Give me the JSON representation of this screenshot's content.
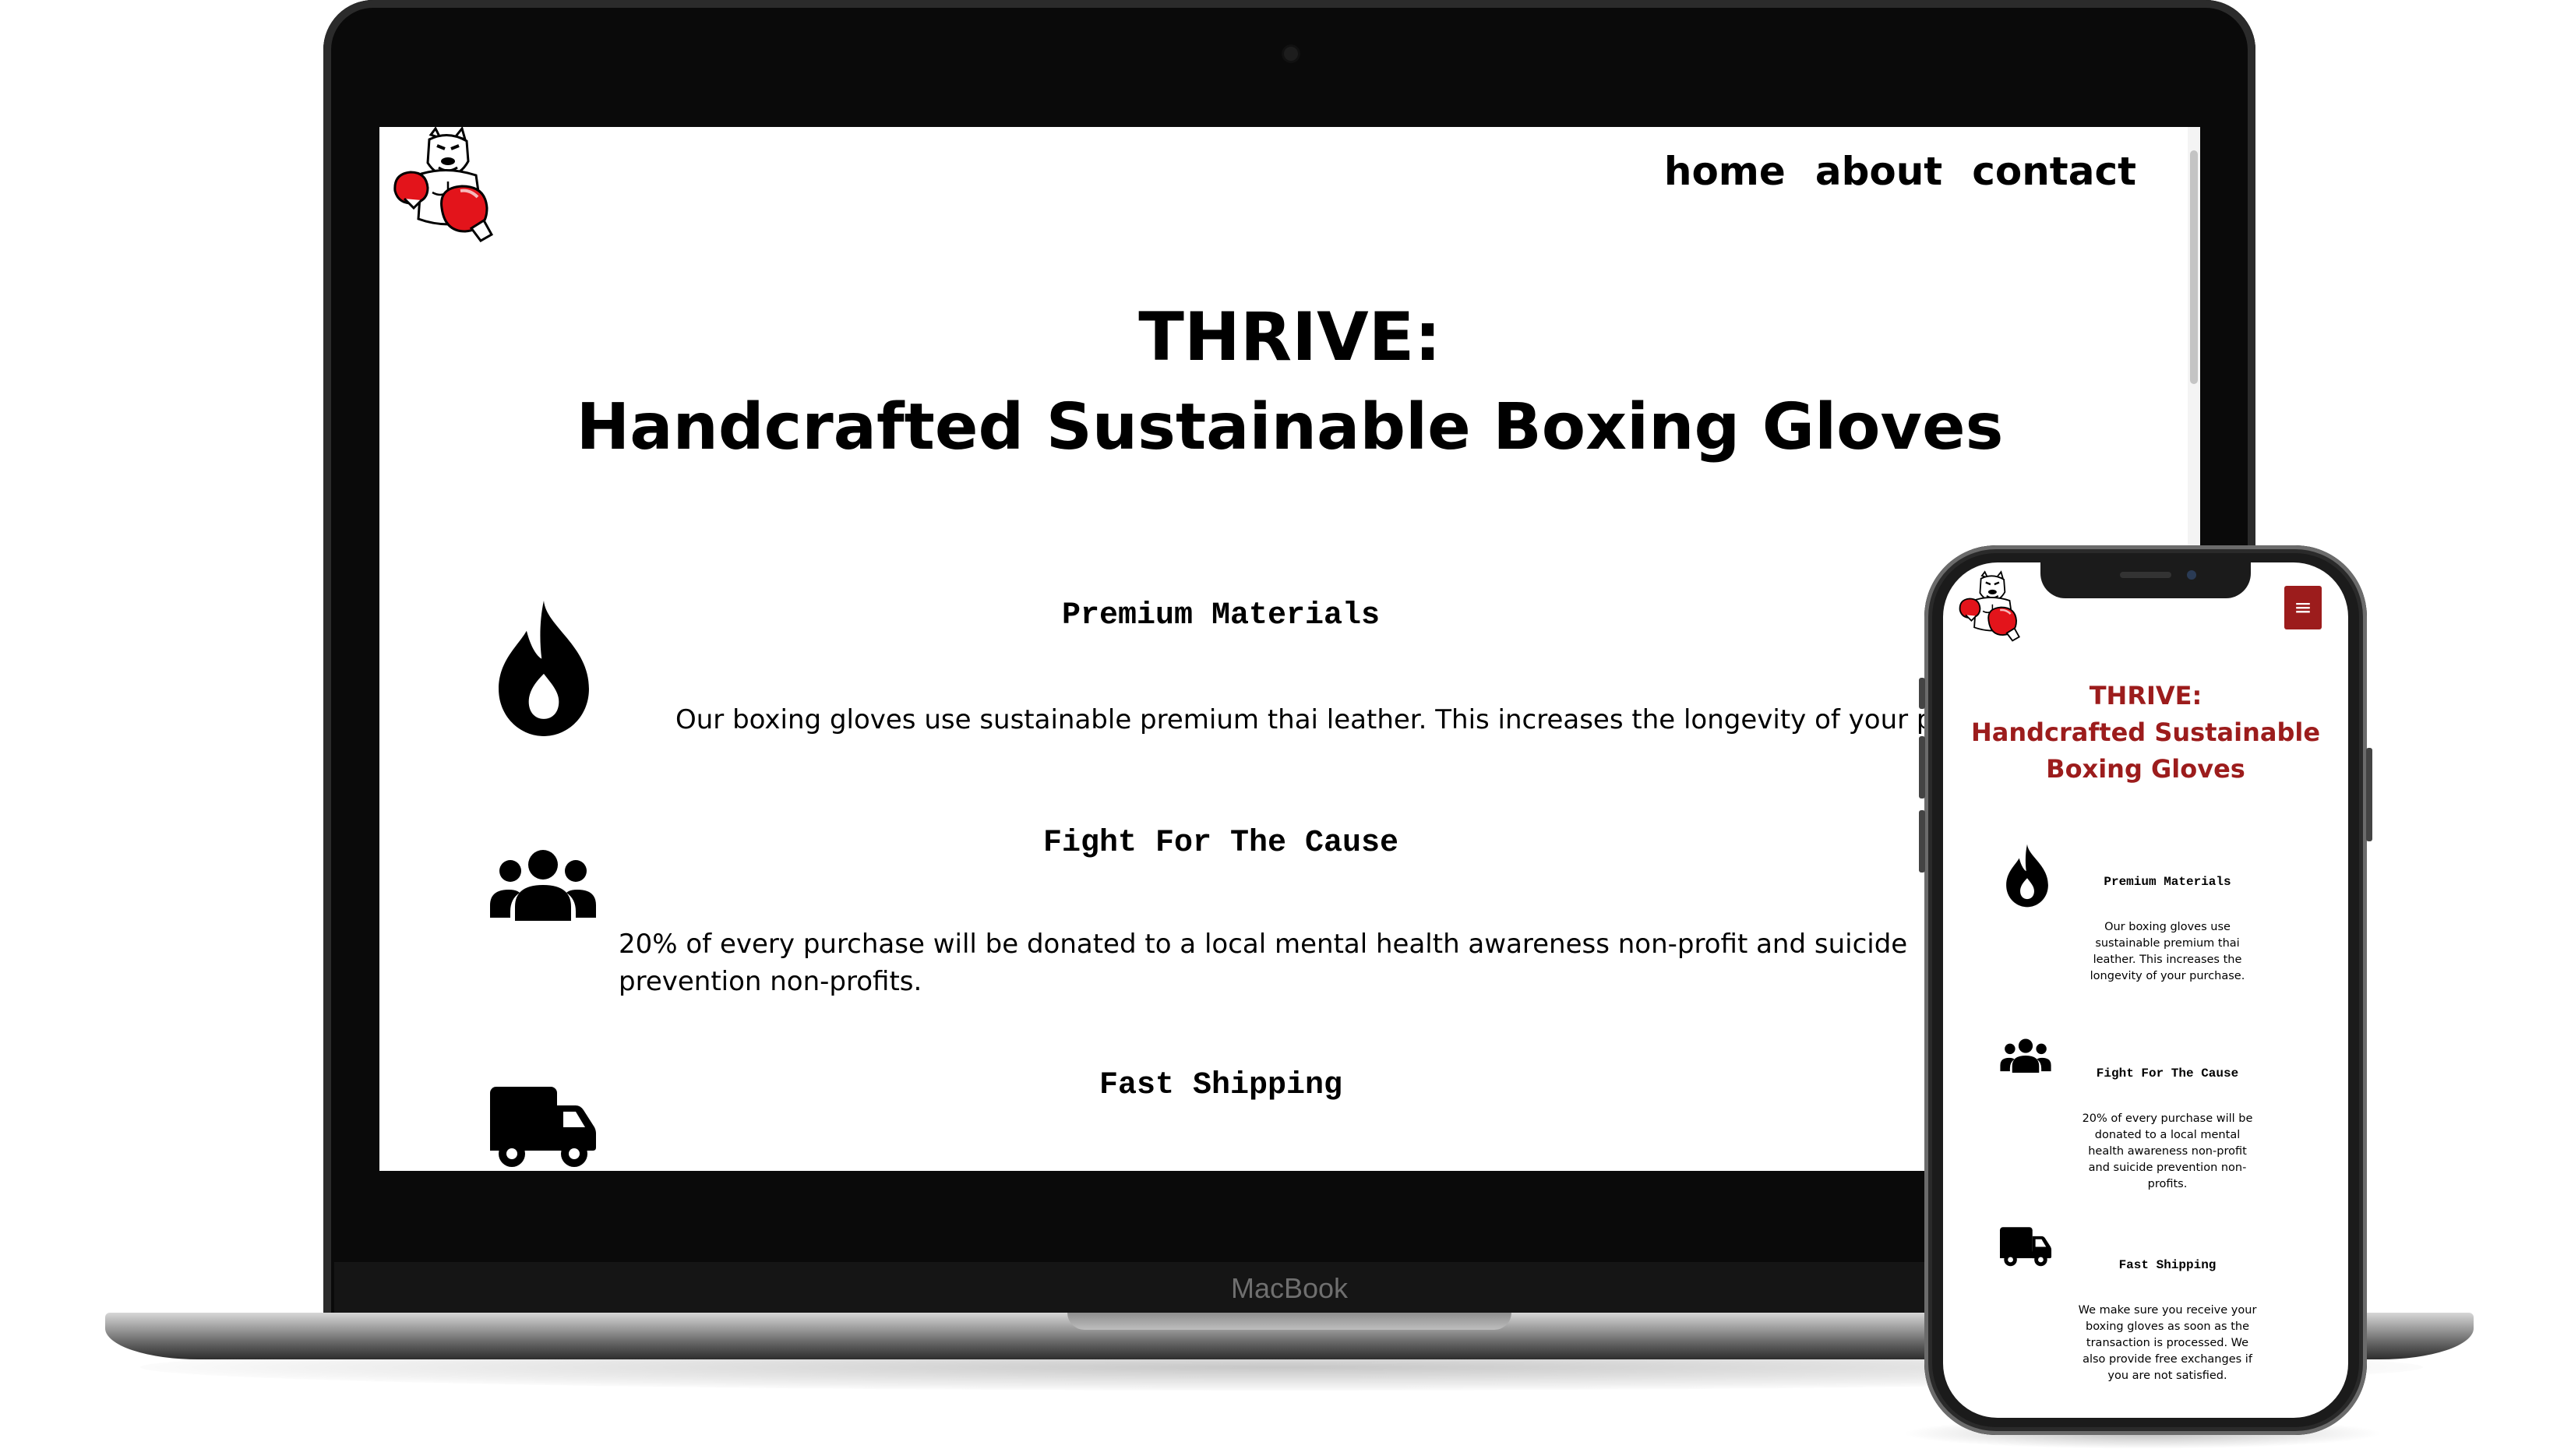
{
  "laptop": {
    "brand": "MacBook",
    "nav": {
      "home": "home",
      "about": "about",
      "contact": "contact"
    },
    "hero": {
      "line1": "THRIVE:",
      "line2": "Handcrafted Sustainable Boxing Gloves"
    },
    "features": [
      {
        "icon": "flame-icon",
        "title": "Premium Materials",
        "text": "Our boxing gloves use sustainable premium thai leather. This increases the longevity of your purchase."
      },
      {
        "icon": "users-icon",
        "title": "Fight For The Cause",
        "text": "20% of every purchase will be donated to a local mental health awareness non-profit and suicide prevention non-profits."
      },
      {
        "icon": "truck-icon",
        "title": "Fast Shipping"
      }
    ]
  },
  "phone": {
    "menu_icon": "≡",
    "hero": {
      "line1": "THRIVE:",
      "line2": "Handcrafted Sustainable",
      "line3": "Boxing Gloves"
    },
    "features": [
      {
        "icon": "flame-icon",
        "title": "Premium Materials",
        "text": "Our boxing gloves use sustainable premium thai leather. This increases the longevity of your purchase."
      },
      {
        "icon": "users-icon",
        "title": "Fight For The Cause",
        "text": "20% of every purchase will be donated to a local mental health awareness non-profit and suicide prevention non-profits."
      },
      {
        "icon": "truck-icon",
        "title": "Fast Shipping",
        "text": "We make sure you receive your boxing gloves as soon as the transaction is processed. We also provide free exchanges if you are not satisfied."
      }
    ]
  },
  "colors": {
    "accent": "#9c1c1c",
    "glove_red": "#e3141b",
    "text": "#000000"
  }
}
